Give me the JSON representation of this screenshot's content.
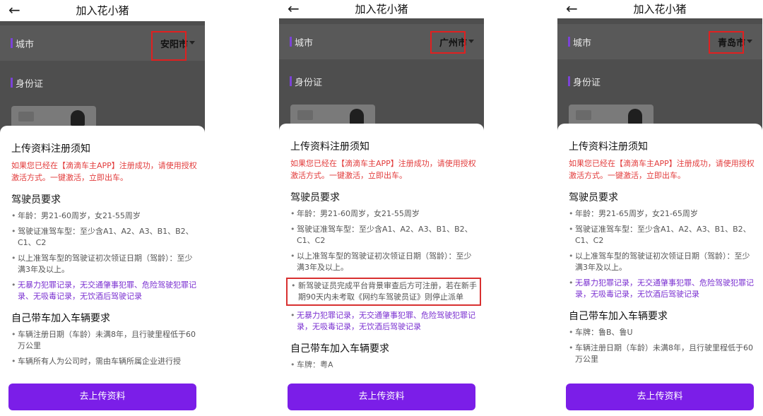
{
  "phones": [
    {
      "nav_title": "加入花小猪",
      "back_icon": "arrow-left-icon",
      "city_label": "城市",
      "city_value": "安阳市",
      "id_label": "身份证",
      "notice_title": "上传资料注册须知",
      "notice_red": "如果您已经在【滴滴车主APP】注册成功，请使用授权激活方式。一键激活，立即出车。",
      "driver_title": "驾驶员要求",
      "driver_items": [
        "年龄：男21-60周岁，女21-55周岁",
        "驾驶证准驾车型：至少含A1、A2、A3、B1、B2、C1、C2",
        "以上准驾车型的驾驶证初次领证日期（驾龄）：至少满3年及以上。",
        "无暴力犯罪记录，无交通肇事犯罪、危险驾驶犯罪记录、无吸毒记录，无饮酒后驾驶记录"
      ],
      "vehicle_title": "自己带车加入车辆要求",
      "vehicle_items": [
        "车辆注册日期（车龄）未满8年，且行驶里程低于60万公里",
        "车辆所有人为公司时，需由车辆所属企业进行授"
      ],
      "cta": "去上传资料"
    },
    {
      "nav_title": "加入花小猪",
      "back_icon": "arrow-left-icon",
      "city_label": "城市",
      "city_value": "广州市",
      "id_label": "身份证",
      "notice_title": "上传资料注册须知",
      "notice_red": "如果您已经在【滴滴车主APP】注册成功，请使用授权激活方式。一键激活，立即出车。",
      "driver_title": "驾驶员要求",
      "driver_items": [
        "年龄：男21-60周岁，女21-55周岁",
        "驾驶证准驾车型：至少含A1、A2、A3、B1、B2、C1、C2",
        "以上准驾车型的驾驶证初次领证日期（驾龄）：至少满3年及以上。",
        "新驾驶证员完成平台背景审查后方可注册，若在新手期90天内未考取《网约车驾驶员证》则停止派单",
        "无暴力犯罪记录，无交通肇事犯罪、危险驾驶犯罪记录，无吸毒记录，无饮酒后驾驶记录"
      ],
      "vehicle_title": "自己带车加入车辆要求",
      "vehicle_items": [
        "车牌：粤A"
      ],
      "cta": "去上传资料"
    },
    {
      "nav_title": "加入花小猪",
      "back_icon": "arrow-left-icon",
      "city_label": "城市",
      "city_value": "青岛市",
      "id_label": "身份证",
      "notice_title": "上传资料注册须知",
      "notice_red": "如果您已经在【滴滴车主APP】注册成功，请使用授权激活方式。一键激活，立即出车。",
      "driver_title": "驾驶员要求",
      "driver_items": [
        "年龄：男21-65周岁，女21-65周岁",
        "驾驶证准驾车型：至少含A1、A2、A3、B1、B2、C1、C2",
        "以上准驾车型的驾驶证初次领证日期（驾龄）：至少满3年及以上。",
        "无暴力犯罪记录，无交通肇事犯罪、危险驾驶犯罪记录，无吸毒记录，无饮酒后驾驶记录"
      ],
      "vehicle_title": "自己带车加入车辆要求",
      "vehicle_items": [
        "车牌：鲁B、鲁U",
        "车辆注册日期（车龄）未满8年，且行驶里程低于60万公里"
      ],
      "cta": "去上传资料"
    }
  ],
  "colors": {
    "accent": "#7b1ee8",
    "warning": "#e23b3b",
    "highlight_box": "#e02020"
  }
}
